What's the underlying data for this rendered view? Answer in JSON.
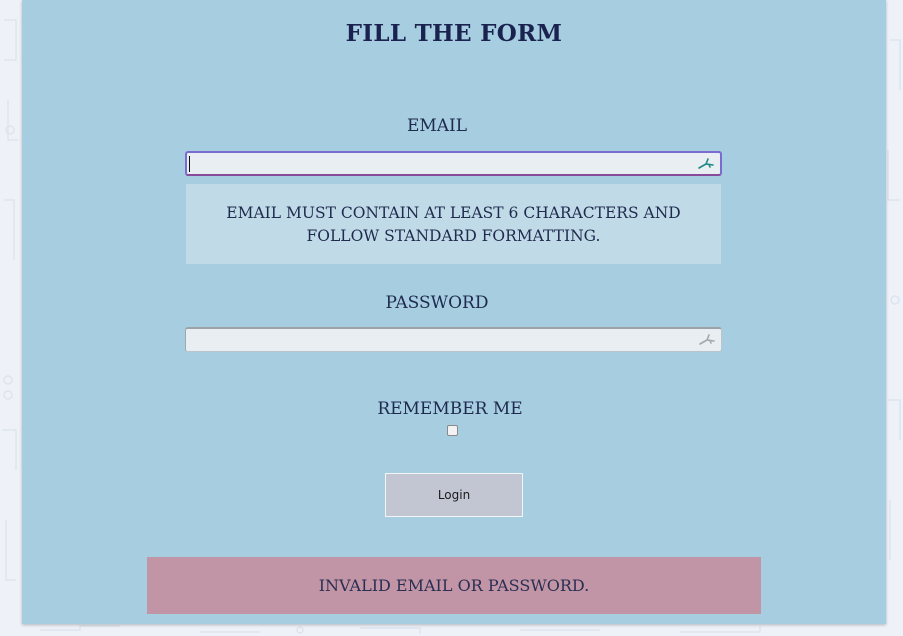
{
  "form": {
    "title": "FILL THE FORM",
    "email_label": "EMAIL",
    "email_value": "",
    "email_placeholder": "",
    "email_hint": "EMAIL MUST CONTAIN AT LEAST 6 CHARACTERS AND FOLLOW STANDARD FORMATTING.",
    "password_label": "PASSWORD",
    "password_value": "",
    "remember_label": "REMEMBER ME",
    "remember_checked": false,
    "login_label": "Login",
    "error_message": "INVALID EMAIL OR PASSWORD."
  },
  "icons": {
    "email_field_icon": "key-icon",
    "password_field_icon": "key-icon"
  },
  "colors": {
    "panel": "#a6cde0",
    "hint_box": "#c0dbe7",
    "error_box": "#c295a6",
    "button": "#c2c5d2",
    "title_text": "#1a2350"
  }
}
